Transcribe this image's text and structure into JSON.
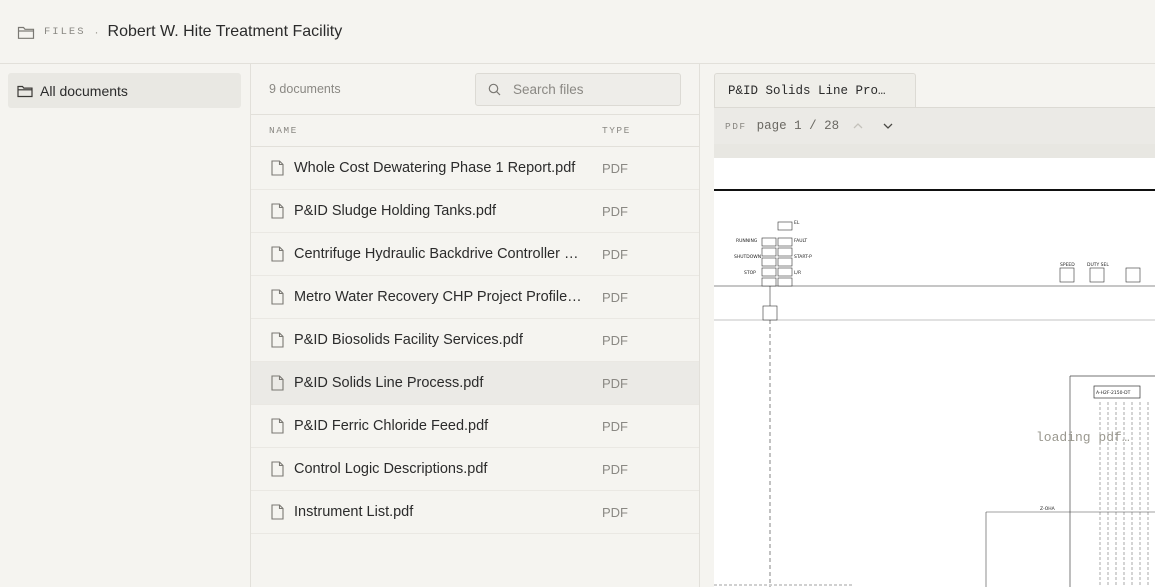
{
  "breadcrumb": {
    "section": "FILES",
    "separator": "·",
    "title": "Robert W. Hite Treatment Facility"
  },
  "sidebar": {
    "items": [
      {
        "label": "All documents",
        "icon": "folder-icon",
        "selected": true
      }
    ]
  },
  "list": {
    "count": "9 documents",
    "search_placeholder": "Search files",
    "columns": {
      "name": "NAME",
      "type": "TYPE"
    },
    "files": [
      {
        "name": "Whole Cost Dewatering Phase 1 Report.pdf",
        "type": "PDF"
      },
      {
        "name": "P&ID Sludge Holding Tanks.pdf",
        "type": "PDF"
      },
      {
        "name": "Centrifuge Hydraulic Backdrive Controller Manual.pdf",
        "type": "PDF"
      },
      {
        "name": "Metro Water Recovery CHP Project Profile.pdf",
        "type": "PDF"
      },
      {
        "name": "P&ID Biosolids Facility Services.pdf",
        "type": "PDF"
      },
      {
        "name": "P&ID Solids Line Process.pdf",
        "type": "PDF"
      },
      {
        "name": "P&ID Ferric Chloride Feed.pdf",
        "type": "PDF"
      },
      {
        "name": "Control Logic Descriptions.pdf",
        "type": "PDF"
      },
      {
        "name": "Instrument List.pdf",
        "type": "PDF"
      }
    ],
    "selected_index": 5
  },
  "viewer": {
    "tab_label": "P&ID Solids Line Pro…",
    "format_label": "PDF",
    "page_indicator": "page 1 / 28",
    "loading_text": "loading pdf…",
    "drawing_labels": {
      "d1": "EL",
      "d2": "RUNNING",
      "d3": "FAULT",
      "d4": "SHUTDOWN",
      "d5": "START-P",
      "d6": "STOP",
      "d7": "L/R",
      "d8": "SPEED",
      "d9": "DUTY SEL",
      "d10": "A-H2F-2150-DT",
      "d11": "Z-OHA"
    }
  },
  "colors": {
    "background": "#f5f4f0",
    "selected_row": "#ebeae6",
    "border": "#e2e0da",
    "muted_text": "#8a8883"
  }
}
